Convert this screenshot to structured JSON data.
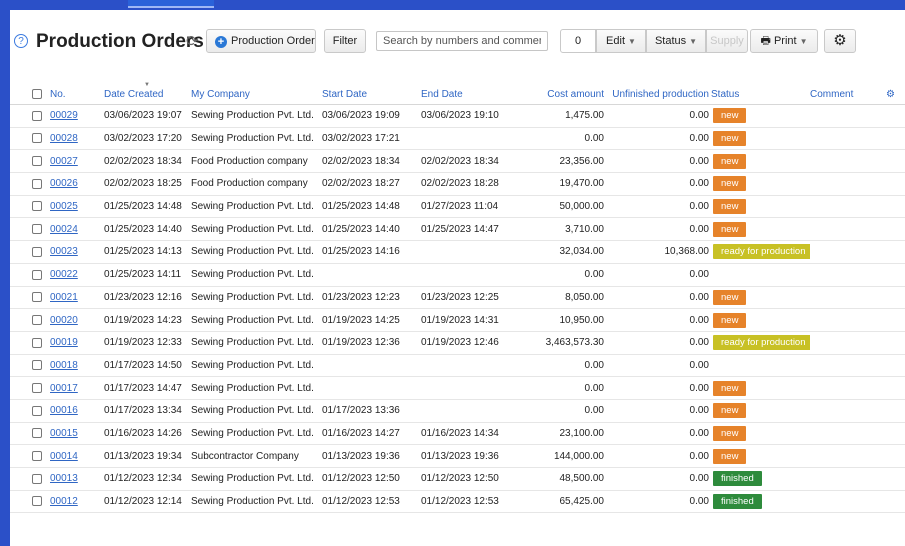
{
  "toolbar": {
    "title": "Production Orders",
    "new_button": "Production Order",
    "filter_button": "Filter",
    "search_placeholder": "Search by numbers and comments",
    "selected_count": "0",
    "edit_label": "Edit",
    "status_label": "Status",
    "supply_label": "Supply",
    "print_label": "Print"
  },
  "columns": {
    "no": "No.",
    "date_created": "Date Created",
    "company": "My Company",
    "start": "Start Date",
    "end": "End Date",
    "cost": "Cost amount",
    "unfinished": "Unfinished production",
    "status": "Status",
    "comment": "Comment"
  },
  "rows": [
    {
      "no": "00029",
      "created": "03/06/2023 19:07",
      "company": "Sewing Production Pvt. Ltd.",
      "start": "03/06/2023 19:09",
      "end": "03/06/2023 19:10",
      "cost": "1,475.00",
      "unfinished": "0.00",
      "status": "new",
      "status_type": "new"
    },
    {
      "no": "00028",
      "created": "03/02/2023 17:20",
      "company": "Sewing Production Pvt. Ltd.",
      "start": "03/02/2023 17:21",
      "end": "",
      "cost": "0.00",
      "unfinished": "0.00",
      "status": "new",
      "status_type": "new"
    },
    {
      "no": "00027",
      "created": "02/02/2023 18:34",
      "company": "Food Production company",
      "start": "02/02/2023 18:34",
      "end": "02/02/2023 18:34",
      "cost": "23,356.00",
      "unfinished": "0.00",
      "status": "new",
      "status_type": "new"
    },
    {
      "no": "00026",
      "created": "02/02/2023 18:25",
      "company": "Food Production company",
      "start": "02/02/2023 18:27",
      "end": "02/02/2023 18:28",
      "cost": "19,470.00",
      "unfinished": "0.00",
      "status": "new",
      "status_type": "new"
    },
    {
      "no": "00025",
      "created": "01/25/2023 14:48",
      "company": "Sewing Production Pvt. Ltd.",
      "start": "01/25/2023 14:48",
      "end": "01/27/2023 11:04",
      "cost": "50,000.00",
      "unfinished": "0.00",
      "status": "new",
      "status_type": "new"
    },
    {
      "no": "00024",
      "created": "01/25/2023 14:40",
      "company": "Sewing Production Pvt. Ltd.",
      "start": "01/25/2023 14:40",
      "end": "01/25/2023 14:47",
      "cost": "3,710.00",
      "unfinished": "0.00",
      "status": "new",
      "status_type": "new"
    },
    {
      "no": "00023",
      "created": "01/25/2023 14:13",
      "company": "Sewing Production Pvt. Ltd.",
      "start": "01/25/2023 14:16",
      "end": "",
      "cost": "32,034.00",
      "unfinished": "10,368.00",
      "status": "ready for production",
      "status_type": "ready"
    },
    {
      "no": "00022",
      "created": "01/25/2023 14:11",
      "company": "Sewing Production Pvt. Ltd.",
      "start": "",
      "end": "",
      "cost": "0.00",
      "unfinished": "0.00",
      "status": "",
      "status_type": ""
    },
    {
      "no": "00021",
      "created": "01/23/2023 12:16",
      "company": "Sewing Production Pvt. Ltd.",
      "start": "01/23/2023 12:23",
      "end": "01/23/2023 12:25",
      "cost": "8,050.00",
      "unfinished": "0.00",
      "status": "new",
      "status_type": "new"
    },
    {
      "no": "00020",
      "created": "01/19/2023 14:23",
      "company": "Sewing Production Pvt. Ltd.",
      "start": "01/19/2023 14:25",
      "end": "01/19/2023 14:31",
      "cost": "10,950.00",
      "unfinished": "0.00",
      "status": "new",
      "status_type": "new"
    },
    {
      "no": "00019",
      "created": "01/19/2023 12:33",
      "company": "Sewing Production Pvt. Ltd.",
      "start": "01/19/2023 12:36",
      "end": "01/19/2023 12:46",
      "cost": "3,463,573.30",
      "unfinished": "0.00",
      "status": "ready for production",
      "status_type": "ready"
    },
    {
      "no": "00018",
      "created": "01/17/2023 14:50",
      "company": "Sewing Production Pvt. Ltd.",
      "start": "",
      "end": "",
      "cost": "0.00",
      "unfinished": "0.00",
      "status": "",
      "status_type": ""
    },
    {
      "no": "00017",
      "created": "01/17/2023 14:47",
      "company": "Sewing Production Pvt. Ltd.",
      "start": "",
      "end": "",
      "cost": "0.00",
      "unfinished": "0.00",
      "status": "new",
      "status_type": "new"
    },
    {
      "no": "00016",
      "created": "01/17/2023 13:34",
      "company": "Sewing Production Pvt. Ltd.",
      "start": "01/17/2023 13:36",
      "end": "",
      "cost": "0.00",
      "unfinished": "0.00",
      "status": "new",
      "status_type": "new"
    },
    {
      "no": "00015",
      "created": "01/16/2023 14:26",
      "company": "Sewing Production Pvt. Ltd.",
      "start": "01/16/2023 14:27",
      "end": "01/16/2023 14:34",
      "cost": "23,100.00",
      "unfinished": "0.00",
      "status": "new",
      "status_type": "new"
    },
    {
      "no": "00014",
      "created": "01/13/2023 19:34",
      "company": "Subcontractor Company",
      "start": "01/13/2023 19:36",
      "end": "01/13/2023 19:36",
      "cost": "144,000.00",
      "unfinished": "0.00",
      "status": "new",
      "status_type": "new"
    },
    {
      "no": "00013",
      "created": "01/12/2023 12:34",
      "company": "Sewing Production Pvt. Ltd.",
      "start": "01/12/2023 12:50",
      "end": "01/12/2023 12:50",
      "cost": "48,500.00",
      "unfinished": "0.00",
      "status": "finished",
      "status_type": "finished"
    },
    {
      "no": "00012",
      "created": "01/12/2023 12:14",
      "company": "Sewing Production Pvt. Ltd.",
      "start": "01/12/2023 12:53",
      "end": "01/12/2023 12:53",
      "cost": "65,425.00",
      "unfinished": "0.00",
      "status": "finished",
      "status_type": "finished"
    }
  ]
}
